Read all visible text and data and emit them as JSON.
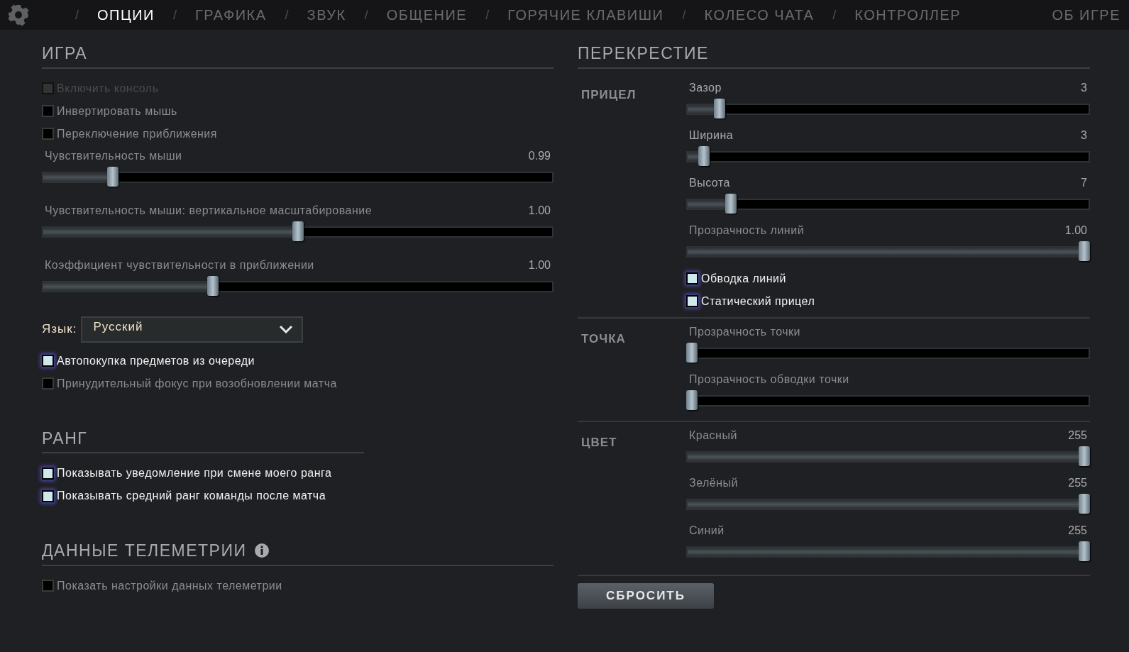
{
  "tabs": [
    {
      "label": "ОПЦИИ",
      "separator": "/",
      "selected": true
    },
    {
      "label": "ГРАФИКА",
      "separator": "/",
      "selected": false
    },
    {
      "label": "ЗВУК",
      "separator": "/",
      "selected": false
    },
    {
      "label": "ОБЩЕНИЕ",
      "separator": "/",
      "selected": false
    },
    {
      "label": "ГОРЯЧИЕ КЛАВИШИ",
      "separator": "/",
      "selected": false
    },
    {
      "label": "КОЛЕСО ЧАТА",
      "separator": "/",
      "selected": false
    },
    {
      "label": "КОНТРОЛЛЕР",
      "separator": "/",
      "selected": false
    }
  ],
  "about_tab": {
    "label": "ОБ ИГРЕ",
    "selected": false
  },
  "game": {
    "title": "ИГРА",
    "items": [
      {
        "kind": "checkbox",
        "label": "Включить консоль",
        "checked": false,
        "disabled": true
      },
      {
        "kind": "checkbox",
        "label": "Инвертировать мышь",
        "checked": false,
        "disabled": false
      },
      {
        "kind": "checkbox",
        "label": "Переключение приближения",
        "checked": false,
        "disabled": false
      },
      {
        "kind": "slider",
        "label": "Чувствительность мыши",
        "reading": "0.99",
        "level": 0.13
      },
      {
        "kind": "slider",
        "label": "Чувствительность мыши: вертикальное масштабирование",
        "reading": "1.00",
        "level": 0.5
      },
      {
        "kind": "slider",
        "label": "Коэффициент чувствительности в приближении",
        "reading": "1.00",
        "level": 0.33
      },
      {
        "kind": "select",
        "label": "Язык:",
        "value": "Русский"
      },
      {
        "kind": "checkbox",
        "label": "Автопокупка предметов из очереди",
        "checked": true,
        "disabled": false
      },
      {
        "kind": "checkbox",
        "label": "Принудительный фокус при возобновлении матча",
        "checked": false,
        "disabled": false
      }
    ]
  },
  "rank": {
    "title": "РАНГ",
    "items": [
      {
        "kind": "checkbox",
        "label": "Показывать уведомление при смене моего ранга",
        "checked": true,
        "disabled": false
      },
      {
        "kind": "checkbox",
        "label": "Показывать средний ранг команды после матча",
        "checked": true,
        "disabled": false
      }
    ]
  },
  "telemetry": {
    "title": "ДАННЫЕ ТЕЛЕМЕТРИИ",
    "items": [
      {
        "kind": "checkbox",
        "label": "Показать настройки данных телеметрии",
        "checked": false,
        "disabled": false
      }
    ]
  },
  "crosshair": {
    "title": "ПЕРЕКРЕСТИЕ",
    "groups": [
      {
        "label": "ПРИЦЕЛ",
        "items": [
          {
            "kind": "slider",
            "label": "Зазор",
            "reading": "3",
            "level": 0.07
          },
          {
            "kind": "slider",
            "label": "Ширина",
            "reading": "3",
            "level": 0.03
          },
          {
            "kind": "slider",
            "label": "Высота",
            "reading": "7",
            "level": 0.1
          },
          {
            "kind": "slider",
            "label": "Прозрачность линий",
            "reading": "1.00",
            "level": 1
          },
          {
            "kind": "checkbox",
            "label": "Обводка линий",
            "checked": true,
            "disabled": false
          },
          {
            "kind": "checkbox",
            "label": "Статический прицел",
            "checked": true,
            "disabled": false
          }
        ]
      },
      {
        "label": "ТОЧКА",
        "items": [
          {
            "kind": "slider",
            "label": "Прозрачность точки",
            "level": 0
          },
          {
            "kind": "slider",
            "label": "Прозрачность обводки точки",
            "level": 0
          }
        ]
      },
      {
        "label": "ЦВЕТ",
        "items": [
          {
            "kind": "slider",
            "label": "Красный",
            "reading": "255",
            "level": 1
          },
          {
            "kind": "slider",
            "label": "Зелёный",
            "reading": "255",
            "level": 1
          },
          {
            "kind": "slider",
            "label": "Синий",
            "reading": "255",
            "level": 1
          }
        ]
      }
    ],
    "reset_button": "СБРОСИТЬ"
  }
}
